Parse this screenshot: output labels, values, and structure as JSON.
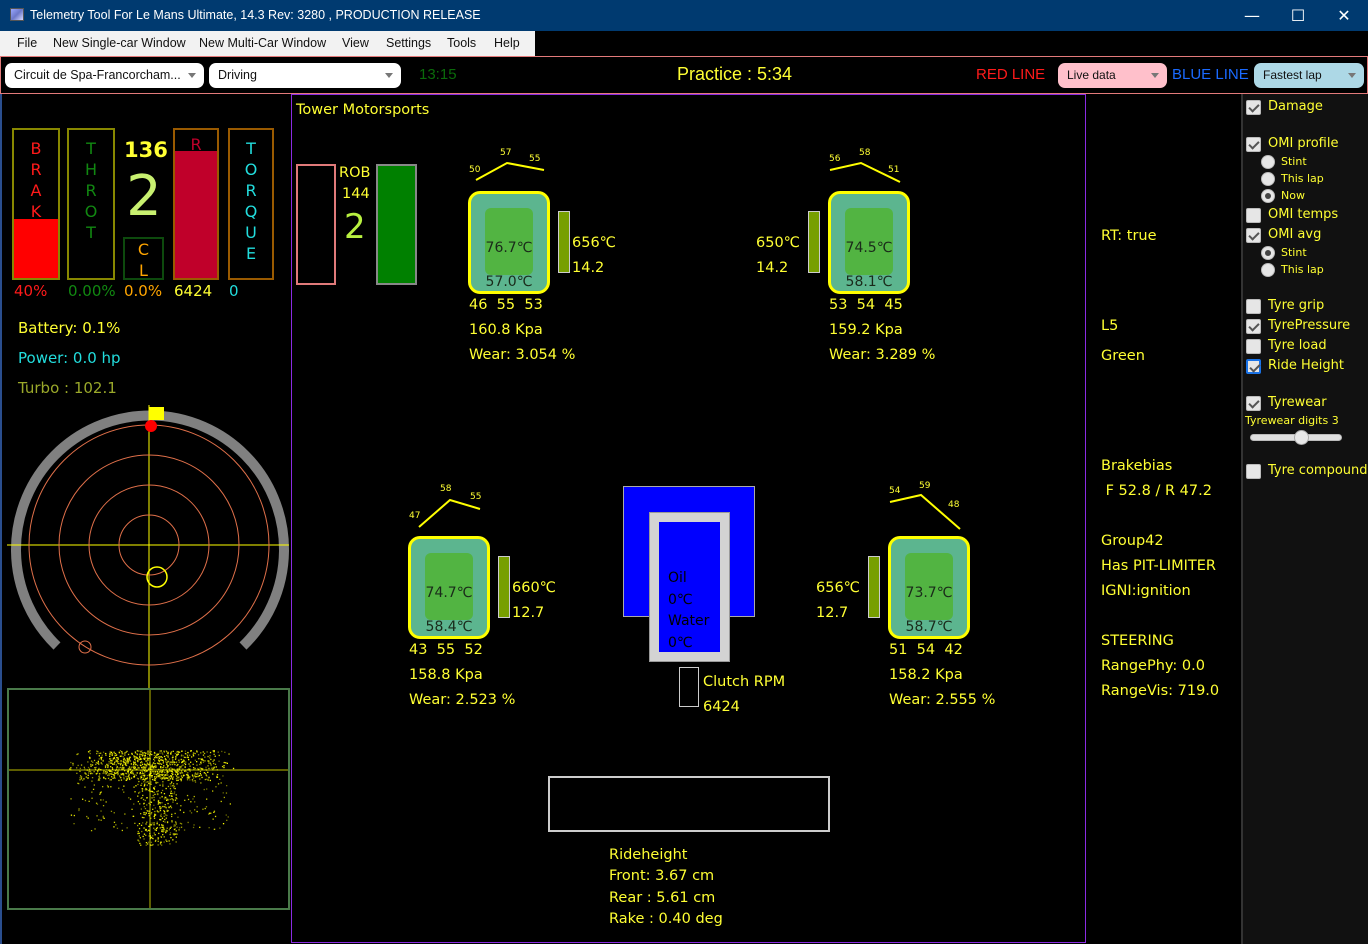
{
  "window": {
    "title": "Telemetry Tool For Le Mans Ultimate, 14.3 Rev: 3280 , PRODUCTION RELEASE",
    "minimize": "—",
    "maximize": "☐",
    "close": "✕"
  },
  "menu": [
    "File",
    "New Single-car Window",
    "New Multi-Car Window",
    "View",
    "Settings",
    "Tools",
    "Help"
  ],
  "toolbar": {
    "track": "Circuit de Spa-Francorcham...",
    "mode": "Driving",
    "clock": "13:15",
    "session": "Practice : 5:34",
    "red_line_label": "RED LINE",
    "red_line_value": "Live data",
    "blue_line_label": "BLUE LINE",
    "blue_line_value": "Fastest lap"
  },
  "colors": {
    "title_bar": "#003a70",
    "panel_border": "#8a2be2",
    "toolbar_border": "#e37a7a",
    "text_yellow": "#ffff33",
    "brake_fill": "#ff0000",
    "rpm_fill": "#c0002a",
    "tyre_outer": "#5cb58f",
    "tyre_inner": "#52b442",
    "engine_blue": "#0000ff",
    "red_combo": "#ffc0cb",
    "blue_combo": "#add8e6"
  },
  "pedals": {
    "brake": {
      "label": [
        "B",
        "R",
        "A",
        "K"
      ],
      "value": "40%",
      "fill": 0.4
    },
    "throttle": {
      "label": [
        "T",
        "H",
        "R",
        "O",
        "T"
      ],
      "value": "0.00%",
      "fill": 0.0
    },
    "speed": "136",
    "gear": "2",
    "clutch": {
      "label": [
        "C",
        "L"
      ],
      "value": "0.0%"
    },
    "rpm": {
      "label": "R",
      "value": "6424",
      "fill": 0.86
    },
    "torque": {
      "label": [
        "T",
        "O",
        "R",
        "Q",
        "U",
        "E"
      ],
      "value": "0"
    }
  },
  "stats": {
    "battery": "Battery: 0.1%",
    "power": "Power: 0.0 hp",
    "turbo": "Turbo : 102.1"
  },
  "team": "Tower Motorsports",
  "driver": {
    "code": "ROB",
    "number": "144",
    "position": "2"
  },
  "tyres": {
    "fl": {
      "profile": [
        "50",
        "57",
        "55"
      ],
      "inner": "76.7℃",
      "carcass": "57.0℃",
      "brake_temp": "656℃",
      "brake_val": "14.2",
      "surface": "46  55  53",
      "pressure": "160.8 Kpa",
      "wear": "Wear: 3.054 %"
    },
    "fr": {
      "profile": [
        "56",
        "58",
        "51"
      ],
      "inner": "74.5℃",
      "carcass": "58.1℃",
      "brake_temp": "650℃",
      "brake_val": "14.2",
      "surface": "53  54  45",
      "pressure": "159.2 Kpa",
      "wear": "Wear: 3.289 %"
    },
    "rl": {
      "profile": [
        "47",
        "58",
        "55"
      ],
      "inner": "74.7℃",
      "carcass": "58.4℃",
      "brake_temp": "660℃",
      "brake_val": "12.7",
      "surface": "43  55  52",
      "pressure": "158.8 Kpa",
      "wear": "Wear: 2.523 %"
    },
    "rr": {
      "profile": [
        "54",
        "59",
        "48"
      ],
      "inner": "73.7℃",
      "carcass": "58.7℃",
      "brake_temp": "656℃",
      "brake_val": "12.7",
      "surface": "51  54  42",
      "pressure": "158.2 Kpa",
      "wear": "Wear: 2.555 %"
    }
  },
  "engine": {
    "oil_label": "Oil",
    "oil": "0℃",
    "water_label": "Water",
    "water": "0℃"
  },
  "clutch_rpm": {
    "label": "Clutch RPM",
    "value": "6424"
  },
  "rideheight": {
    "title": "Rideheight",
    "front": "Front: 3.67 cm",
    "rear": "Rear : 5.61 cm",
    "rake": "Rake : 0.40 deg"
  },
  "info": {
    "rt": "RT: true",
    "l5": "L5",
    "flag": "Green",
    "brakebias_label": "Brakebias",
    "brakebias": " F 52.8 / R 47.2",
    "group": "Group42",
    "pit": "Has PIT-LIMITER",
    "igni": "IGNI:ignition",
    "steering": "STEERING",
    "range_phy": "RangePhy: 0.0",
    "range_vis": "RangeVis: 719.0"
  },
  "options": {
    "damage": {
      "label": "Damage",
      "checked": true
    },
    "omi_profile": {
      "label": "OMI profile",
      "checked": true,
      "radios": [
        "Stint",
        "This lap",
        "Now"
      ],
      "selected": 2
    },
    "omi_temps": {
      "label": "OMI temps",
      "checked": false
    },
    "omi_avg": {
      "label": "OMI avg",
      "checked": true,
      "radios": [
        "Stint",
        "This lap"
      ],
      "selected": 0
    },
    "tyre_grip": {
      "label": "Tyre grip",
      "checked": false
    },
    "tyre_pressure": {
      "label": "TyrePressure",
      "checked": true
    },
    "tyre_load": {
      "label": "Tyre load",
      "checked": false
    },
    "ride_height": {
      "label": "Ride Height",
      "checked": true
    },
    "tyrewear": {
      "label": "Tyrewear",
      "checked": true
    },
    "tyrewear_digits": {
      "label": "Tyrewear digits 3",
      "value": 3,
      "fraction": 0.55
    },
    "tyre_compound": {
      "label": "Tyre compound",
      "checked": false
    }
  }
}
